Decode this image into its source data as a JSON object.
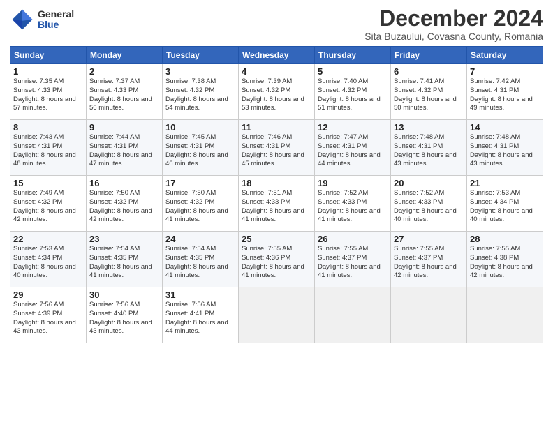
{
  "header": {
    "logo_general": "General",
    "logo_blue": "Blue",
    "month_title": "December 2024",
    "subtitle": "Sita Buzaului, Covasna County, Romania"
  },
  "weekdays": [
    "Sunday",
    "Monday",
    "Tuesday",
    "Wednesday",
    "Thursday",
    "Friday",
    "Saturday"
  ],
  "weeks": [
    [
      {
        "day": "1",
        "sunrise": "7:35 AM",
        "sunset": "4:33 PM",
        "daylight": "8 hours and 57 minutes."
      },
      {
        "day": "2",
        "sunrise": "7:37 AM",
        "sunset": "4:33 PM",
        "daylight": "8 hours and 56 minutes."
      },
      {
        "day": "3",
        "sunrise": "7:38 AM",
        "sunset": "4:32 PM",
        "daylight": "8 hours and 54 minutes."
      },
      {
        "day": "4",
        "sunrise": "7:39 AM",
        "sunset": "4:32 PM",
        "daylight": "8 hours and 53 minutes."
      },
      {
        "day": "5",
        "sunrise": "7:40 AM",
        "sunset": "4:32 PM",
        "daylight": "8 hours and 51 minutes."
      },
      {
        "day": "6",
        "sunrise": "7:41 AM",
        "sunset": "4:32 PM",
        "daylight": "8 hours and 50 minutes."
      },
      {
        "day": "7",
        "sunrise": "7:42 AM",
        "sunset": "4:31 PM",
        "daylight": "8 hours and 49 minutes."
      }
    ],
    [
      {
        "day": "8",
        "sunrise": "7:43 AM",
        "sunset": "4:31 PM",
        "daylight": "8 hours and 48 minutes."
      },
      {
        "day": "9",
        "sunrise": "7:44 AM",
        "sunset": "4:31 PM",
        "daylight": "8 hours and 47 minutes."
      },
      {
        "day": "10",
        "sunrise": "7:45 AM",
        "sunset": "4:31 PM",
        "daylight": "8 hours and 46 minutes."
      },
      {
        "day": "11",
        "sunrise": "7:46 AM",
        "sunset": "4:31 PM",
        "daylight": "8 hours and 45 minutes."
      },
      {
        "day": "12",
        "sunrise": "7:47 AM",
        "sunset": "4:31 PM",
        "daylight": "8 hours and 44 minutes."
      },
      {
        "day": "13",
        "sunrise": "7:48 AM",
        "sunset": "4:31 PM",
        "daylight": "8 hours and 43 minutes."
      },
      {
        "day": "14",
        "sunrise": "7:48 AM",
        "sunset": "4:31 PM",
        "daylight": "8 hours and 43 minutes."
      }
    ],
    [
      {
        "day": "15",
        "sunrise": "7:49 AM",
        "sunset": "4:32 PM",
        "daylight": "8 hours and 42 minutes."
      },
      {
        "day": "16",
        "sunrise": "7:50 AM",
        "sunset": "4:32 PM",
        "daylight": "8 hours and 42 minutes."
      },
      {
        "day": "17",
        "sunrise": "7:50 AM",
        "sunset": "4:32 PM",
        "daylight": "8 hours and 41 minutes."
      },
      {
        "day": "18",
        "sunrise": "7:51 AM",
        "sunset": "4:33 PM",
        "daylight": "8 hours and 41 minutes."
      },
      {
        "day": "19",
        "sunrise": "7:52 AM",
        "sunset": "4:33 PM",
        "daylight": "8 hours and 41 minutes."
      },
      {
        "day": "20",
        "sunrise": "7:52 AM",
        "sunset": "4:33 PM",
        "daylight": "8 hours and 40 minutes."
      },
      {
        "day": "21",
        "sunrise": "7:53 AM",
        "sunset": "4:34 PM",
        "daylight": "8 hours and 40 minutes."
      }
    ],
    [
      {
        "day": "22",
        "sunrise": "7:53 AM",
        "sunset": "4:34 PM",
        "daylight": "8 hours and 40 minutes."
      },
      {
        "day": "23",
        "sunrise": "7:54 AM",
        "sunset": "4:35 PM",
        "daylight": "8 hours and 41 minutes."
      },
      {
        "day": "24",
        "sunrise": "7:54 AM",
        "sunset": "4:35 PM",
        "daylight": "8 hours and 41 minutes."
      },
      {
        "day": "25",
        "sunrise": "7:55 AM",
        "sunset": "4:36 PM",
        "daylight": "8 hours and 41 minutes."
      },
      {
        "day": "26",
        "sunrise": "7:55 AM",
        "sunset": "4:37 PM",
        "daylight": "8 hours and 41 minutes."
      },
      {
        "day": "27",
        "sunrise": "7:55 AM",
        "sunset": "4:37 PM",
        "daylight": "8 hours and 42 minutes."
      },
      {
        "day": "28",
        "sunrise": "7:55 AM",
        "sunset": "4:38 PM",
        "daylight": "8 hours and 42 minutes."
      }
    ],
    [
      {
        "day": "29",
        "sunrise": "7:56 AM",
        "sunset": "4:39 PM",
        "daylight": "8 hours and 43 minutes."
      },
      {
        "day": "30",
        "sunrise": "7:56 AM",
        "sunset": "4:40 PM",
        "daylight": "8 hours and 43 minutes."
      },
      {
        "day": "31",
        "sunrise": "7:56 AM",
        "sunset": "4:41 PM",
        "daylight": "8 hours and 44 minutes."
      },
      null,
      null,
      null,
      null
    ]
  ]
}
